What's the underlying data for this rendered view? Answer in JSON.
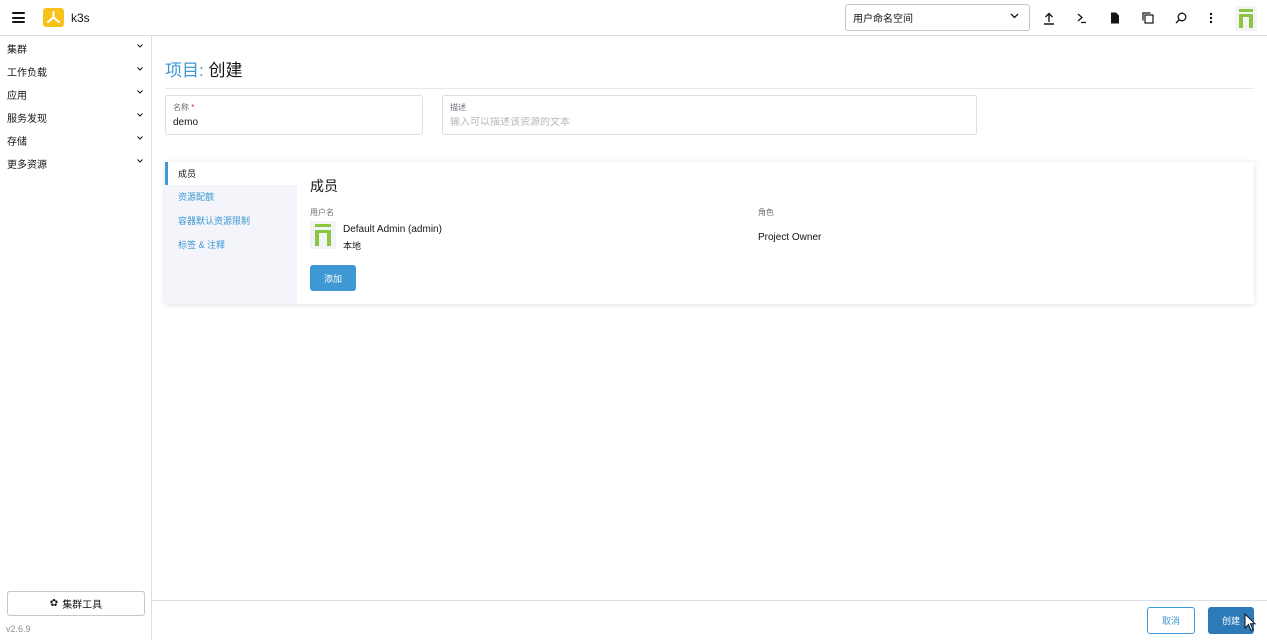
{
  "header": {
    "cluster_name": "k3s",
    "namespace_select": "用户命名空间",
    "icons": [
      "menu-icon",
      "import-yaml-icon",
      "kubectl-shell-icon",
      "kubeconfig-download-icon",
      "copy-kubeconfig-icon",
      "search-icon",
      "more-icon"
    ]
  },
  "sidebar": {
    "items": [
      {
        "label": "集群"
      },
      {
        "label": "工作负载"
      },
      {
        "label": "应用"
      },
      {
        "label": "服务发现"
      },
      {
        "label": "存储"
      },
      {
        "label": "更多资源"
      }
    ],
    "tools_label": "集群工具",
    "version": "v2.6.9"
  },
  "page": {
    "title_kind": "项目:",
    "title_action": "创建"
  },
  "form": {
    "name_label": "名称",
    "required_mark": "*",
    "name_value": "demo",
    "description_label": "描述",
    "description_placeholder": "输入可以描述该资源的文本"
  },
  "tabs": [
    {
      "label": "成员",
      "active": true
    },
    {
      "label": "资源配额"
    },
    {
      "label": "容器默认资源限制"
    },
    {
      "label": "标签 & 注释"
    }
  ],
  "members": {
    "section_title": "成员",
    "col_username": "用户名",
    "col_role": "角色",
    "rows": [
      {
        "name": "Default Admin (admin)",
        "provider": "本地",
        "role": "Project Owner"
      }
    ],
    "add_label": "添加"
  },
  "footer": {
    "cancel_label": "取消",
    "create_label": "创建"
  },
  "colors": {
    "accent": "#3d98d3",
    "primary_button": "#2d7ab8",
    "logo": "#f8c21c",
    "avatar_green": "#8cc63f"
  }
}
